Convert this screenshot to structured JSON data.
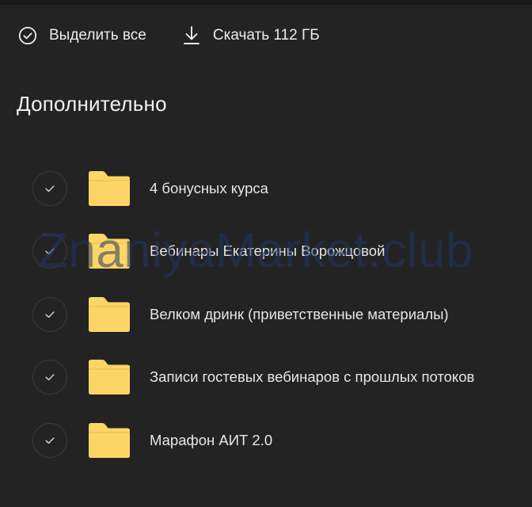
{
  "toolbar": {
    "select_all_label": "Выделить все",
    "download_label": "Скачать 112 ГБ"
  },
  "section": {
    "title": "Дополнительно"
  },
  "folders": [
    {
      "name": "4 бонусных курса"
    },
    {
      "name": "Вебинары Екатерины Ворожцовой"
    },
    {
      "name": "Велком дринк (приветственные материалы)"
    },
    {
      "name": "Записи гостевых вебинаров с прошлых потоков"
    },
    {
      "name": "Марафон АИТ 2.0"
    }
  ],
  "watermark": "ZnaniyaMarket.club",
  "colors": {
    "background": "#232323",
    "folder": "#fcd566",
    "text": "#e6e6e6",
    "watermark": "#233764"
  },
  "icons": {
    "select_all": "check-circle-icon",
    "download": "download-icon",
    "row_check": "check-icon",
    "folder": "folder-icon"
  }
}
